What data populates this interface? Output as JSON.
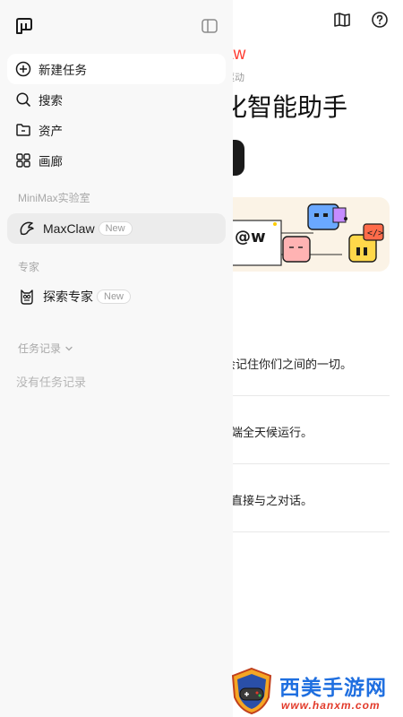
{
  "main": {
    "brand_fragment": "aw",
    "subtitle_fragment": "力驱动",
    "title_fragment": "生化智能助手",
    "banner_tag": "@w",
    "features": [
      "会记住你们之间的一切。",
      "端全天候运行。",
      "直接与之对话。"
    ]
  },
  "sidebar": {
    "nav": [
      {
        "label": "新建任务",
        "icon": "plus-circle-icon"
      },
      {
        "label": "搜索",
        "icon": "search-icon"
      },
      {
        "label": "资产",
        "icon": "folder-icon"
      },
      {
        "label": "画廊",
        "icon": "grid-icon"
      }
    ],
    "lab_section": "MiniMax实验室",
    "maxclaw": {
      "label": "MaxClaw",
      "badge": "New"
    },
    "expert_section": "专家",
    "explore": {
      "label": "探索专家",
      "badge": "New"
    },
    "history_label": "任务记录",
    "history_empty": "没有任务记录"
  },
  "watermark": {
    "title": "西美手游网",
    "url": "www.hanxm.com"
  },
  "colors": {
    "sidebar_bg": "#f8f8f8",
    "brand_red": "#ff3b30",
    "watermark_blue": "#1f6fe0",
    "watermark_red": "#e23a2a"
  }
}
